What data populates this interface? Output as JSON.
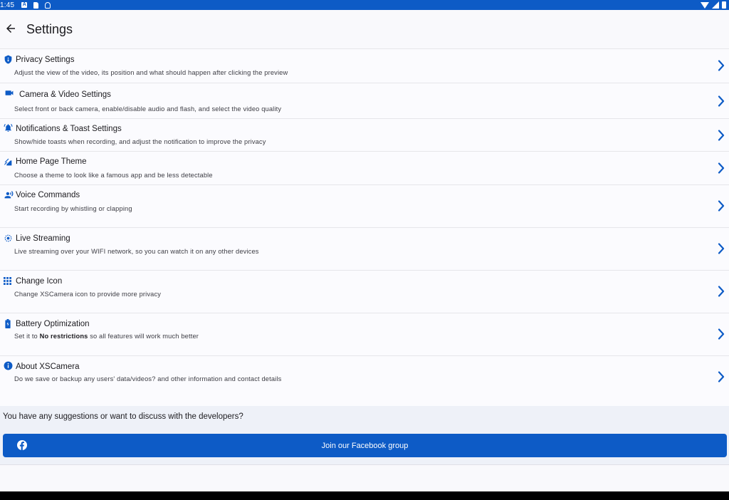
{
  "status_bar": {
    "time": "1:45"
  },
  "header": {
    "title": "Settings"
  },
  "settings": [
    {
      "icon": "shield-icon",
      "title": "Privacy Settings",
      "subtitle": "Adjust the view of the video, its position and what should happen after clicking the preview"
    },
    {
      "icon": "video-camera-icon",
      "title": "Camera & Video Settings",
      "subtitle": "Select front or back camera, enable/disable audio and flash, and select the video quality"
    },
    {
      "icon": "bell-icon",
      "title": "Notifications & Toast Settings",
      "subtitle": "Show/hide toasts when recording, and adjust the notification to improve the privacy"
    },
    {
      "icon": "theme-icon",
      "title": "Home Page Theme",
      "subtitle": "Choose a theme to look like a famous app and be less detectable"
    },
    {
      "icon": "voice-icon",
      "title": "Voice Commands",
      "subtitle": "Start recording by whistling or clapping"
    },
    {
      "icon": "streaming-icon",
      "title": "Live Streaming",
      "subtitle": "Live streaming over your WIFI network, so you can watch it on any other devices"
    },
    {
      "icon": "grid-icon",
      "title": "Change Icon",
      "subtitle": "Change XSCamera icon to provide more privacy"
    },
    {
      "icon": "battery-icon",
      "title": "Battery Optimization",
      "subtitle_prefix": "Set it to ",
      "subtitle_bold": "No restrictions",
      "subtitle_suffix": " so all features will work much better"
    },
    {
      "icon": "info-icon",
      "title": "About XSCamera",
      "subtitle": "Do we save or backup any users' data/videos? and other information and contact details"
    }
  ],
  "footer": {
    "suggestion_text": "You have any suggestions or want to discuss with the developers?",
    "facebook_button": "Join our Facebook group"
  },
  "colors": {
    "accent": "#0d5bc6",
    "background": "#f9f9fc"
  }
}
